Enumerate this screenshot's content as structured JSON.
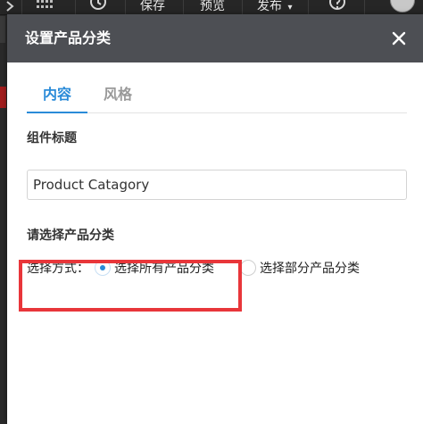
{
  "toolbar": {
    "save_label": "保存",
    "preview_label": "预览",
    "publish_label": "发布",
    "caret": "▾",
    "help_icon": "question-circle",
    "history_icon": "history",
    "grid_icon": "grid"
  },
  "modal": {
    "title": "设置产品分类",
    "close_glyph": "✕",
    "tabs": [
      {
        "label": "内容",
        "active": true
      },
      {
        "label": "风格",
        "active": false
      }
    ],
    "component_title_label": "组件标题",
    "component_title_value": "Product Catagory",
    "category_section_label": "请选择产品分类",
    "select_mode_label": "选择方式：",
    "options": [
      {
        "label": "选择所有产品分类",
        "checked": true
      },
      {
        "label": "选择部分产品分类",
        "checked": false
      }
    ]
  },
  "colors": {
    "accent": "#2a8bd8",
    "header_bg": "#4d4f54",
    "highlight": "#e8363a",
    "toolbar_bg": "#262626"
  }
}
